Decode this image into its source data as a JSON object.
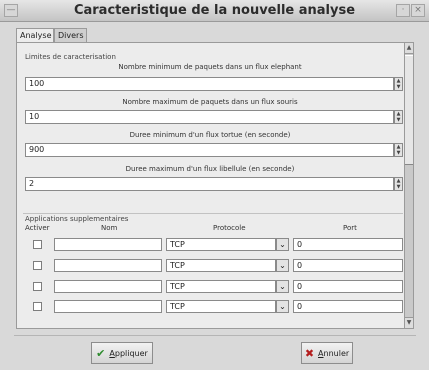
{
  "window": {
    "title": "Caracteristique de la nouvelle analyse"
  },
  "tabs": [
    {
      "label": "Analyse",
      "active": true
    },
    {
      "label": "Divers",
      "active": false
    }
  ],
  "limits": {
    "group_label": "Limites de caracterisation",
    "fields": [
      {
        "label": "Nombre minimum de paquets dans un flux elephant",
        "value": "100"
      },
      {
        "label": "Nombre maximum de paquets dans un flux souris",
        "value": "10"
      },
      {
        "label": "Duree minimum d'un flux tortue (en seconde)",
        "value": "900"
      },
      {
        "label": "Duree maximum d'un flux libellule (en seconde)",
        "value": "2"
      }
    ]
  },
  "apps": {
    "group_label": "Applications supplementaires",
    "columns": {
      "activer": "Activer",
      "nom": "Nom",
      "protocole": "Protocole",
      "port": "Port"
    },
    "rows": [
      {
        "protocol": "TCP",
        "port": "0"
      },
      {
        "protocol": "TCP",
        "port": "0"
      },
      {
        "protocol": "TCP",
        "port": "0"
      },
      {
        "protocol": "TCP",
        "port": "0"
      }
    ]
  },
  "buttons": {
    "apply": {
      "first": "A",
      "rest": "ppliquer"
    },
    "cancel": {
      "first": "A",
      "rest": "nnuler"
    }
  },
  "icons": {
    "apply": "checkmark-icon",
    "cancel": "x-icon",
    "combo": "chevron-down-icon"
  },
  "colors": {
    "apply_icon": "#2e8b2e",
    "cancel_icon": "#b41e1e"
  }
}
